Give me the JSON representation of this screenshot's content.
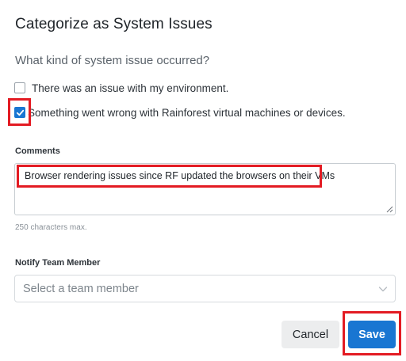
{
  "dialog": {
    "title": "Categorize as System Issues",
    "question": "What kind of system issue occurred?",
    "options": [
      {
        "label": "There was an issue with my environment.",
        "checked": false
      },
      {
        "label": "Something went wrong with Rainforest virtual machines or devices.",
        "checked": true
      }
    ]
  },
  "comments": {
    "label": "Comments",
    "value": "Browser rendering issues since RF updated the browsers on their VMs",
    "hint": "250 characters max."
  },
  "notify": {
    "label": "Notify Team Member",
    "placeholder": "Select a team member"
  },
  "buttons": {
    "cancel": "Cancel",
    "save": "Save"
  },
  "colors": {
    "accent": "#1976d2",
    "annotation": "#e31b23"
  },
  "icons": {
    "check": "check-icon",
    "chevron": "chevron-down-icon",
    "resize": "resize-grip-icon"
  }
}
